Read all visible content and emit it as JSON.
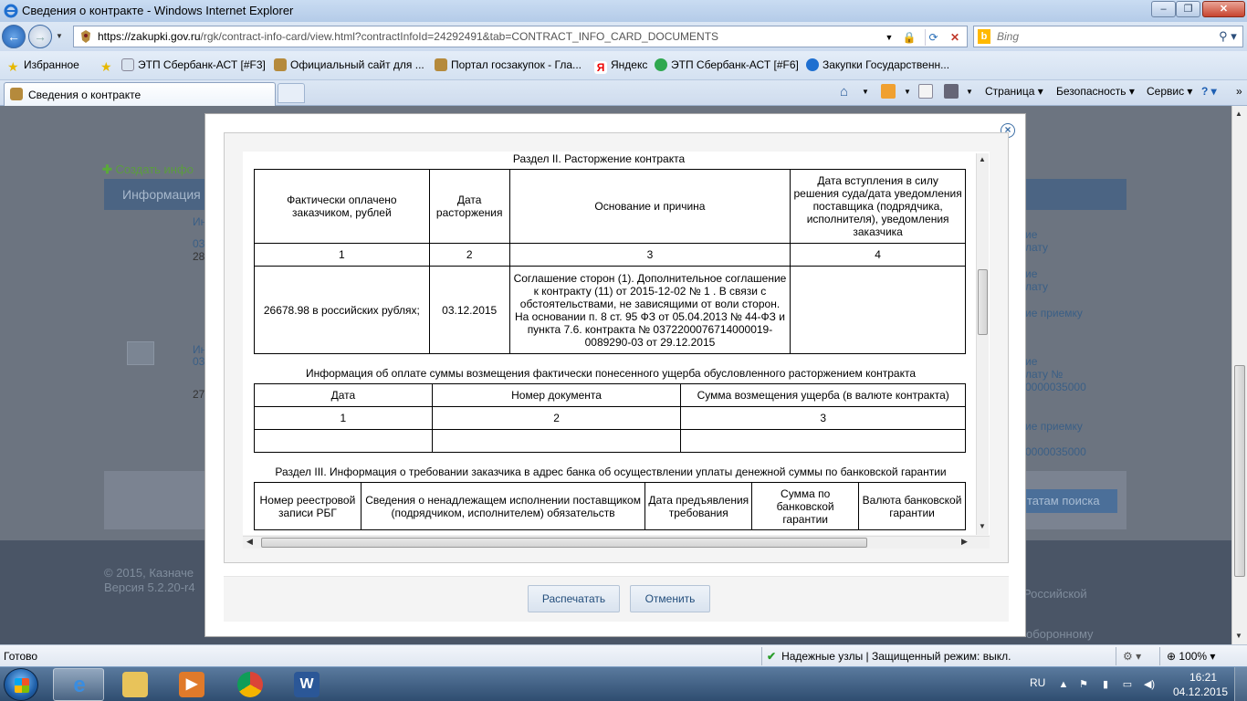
{
  "window": {
    "title": "Сведения о контракте - Windows Internet Explorer"
  },
  "address": {
    "url_host": "https://zakupki.gov.ru",
    "url_path": "/rgk/contract-info-card/view.html?contractInfoId=24292491&tab=CONTRACT_INFO_CARD_DOCUMENTS"
  },
  "search": {
    "placeholder": "Bing"
  },
  "favorites": {
    "label": "Избранное",
    "items": [
      "ЭТП Сбербанк-АСТ [#F3]",
      "Официальный сайт для ...",
      "Портал госзакупок - Гла...",
      "Яндекс",
      "ЭТП Сбербанк-АСТ [#F6]",
      "Закупки  Государственн..."
    ]
  },
  "tab": {
    "label": "Сведения о контракте"
  },
  "commandbar": {
    "page": "Страница",
    "safety": "Безопасность",
    "tools": "Сервис"
  },
  "background": {
    "create_link": "Создать инфо",
    "panel_title": "Информация о",
    "right_links": [
      "ие",
      "лату",
      "ие",
      "лату",
      "ие приемку",
      "ие",
      "лату №",
      "0000035000",
      "ие приемку",
      "0000035000"
    ],
    "search_results_btn": "татам поиска",
    "footer_copyright": "© 2015, Казначе",
    "footer_version": "Версия 5.2.20-r4",
    "footer_right1": "Российской",
    "footer_right2": "оборонному",
    "left_fragments": [
      "Ин",
      "03",
      "28",
      "Ин",
      "03",
      "27"
    ]
  },
  "modal": {
    "section2_title": "Раздел II. Расторжение контракта",
    "termination_table": {
      "headers": [
        "Фактически оплачено заказчиком, рублей",
        "Дата расторжения",
        "Основание и причина",
        "Дата вступления в силу решения суда/дата уведомления поставщика (подрядчика, исполнителя), уведомления заказчика"
      ],
      "numbers": [
        "1",
        "2",
        "3",
        "4"
      ],
      "row": {
        "paid": "26678.98 в российских рублях;",
        "date": "03.12.2015",
        "reason": "Соглашение сторон (1).  Дополнительное соглашение к контракту (11) от 2015-12-02 № 1 . В связи с обстоятельствами, не зависящими от воли сторон. На основании п. 8 ст. 95 ФЗ от 05.04.2013 № 44-ФЗ и пункта 7.6. контракта № 0372200076714000019-0089290-03 от 29.12.2015",
        "effective": ""
      }
    },
    "damage_title": "Информация об оплате суммы возмещения фактически понесенного ущерба обусловленного расторжением контракта",
    "damage_table": {
      "headers": [
        "Дата",
        "Номер документа",
        "Сумма возмещения ущерба (в валюте контракта)"
      ],
      "numbers": [
        "1",
        "2",
        "3"
      ]
    },
    "section3_title": "Раздел III. Информация о требовании заказчика в адрес банка об осуществлении уплаты денежной суммы по банковской гарантии",
    "guarantee_table": {
      "headers": [
        "Номер реестровой записи РБГ",
        "Сведения о ненадлежащем исполнении поставщиком (подрядчиком, исполнителем) обязательств",
        "Дата предъявления требования",
        "Сумма по банковской гарантии",
        "Валюта банковской гарантии"
      ]
    },
    "print_button": "Распечатать",
    "cancel_button": "Отменить"
  },
  "statusbar": {
    "status": "Готово",
    "zone": "Надежные узлы | Защищенный режим: выкл.",
    "zoom": "100%"
  },
  "taskbar": {
    "lang": "RU",
    "time": "16:21",
    "date": "04.12.2015"
  }
}
